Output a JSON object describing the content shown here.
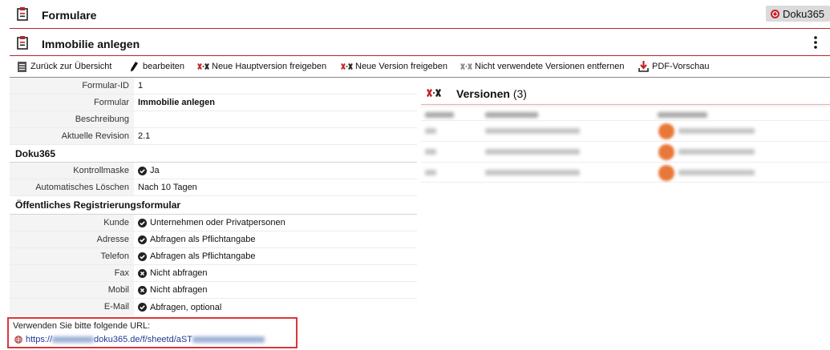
{
  "header": {
    "title": "Formulare",
    "badge": "Doku365"
  },
  "form": {
    "title": "Immobilie anlegen"
  },
  "toolbar": {
    "items": [
      {
        "label": "Zurück zur Übersicht",
        "icon": "list-icon"
      },
      {
        "label": "bearbeiten",
        "icon": "pencil-icon"
      },
      {
        "label": "Neue Hauptversion freigeben",
        "icon": "release-major-version-icon"
      },
      {
        "label": "Neue Version freigeben",
        "icon": "release-version-icon"
      },
      {
        "label": "Nicht verwendete Versionen entfernen",
        "icon": "remove-versions-icon"
      },
      {
        "label": "PDF-Vorschau",
        "icon": "pdf-download-icon"
      }
    ]
  },
  "details": {
    "general": [
      {
        "label": "Formular-ID",
        "value": "1"
      },
      {
        "label": "Formular",
        "value": "Immobilie anlegen"
      },
      {
        "label": "Beschreibung"
      },
      {
        "label": "Aktuelle Revision",
        "value": "2.1"
      }
    ],
    "doku365": {
      "heading": "Doku365",
      "rows": [
        {
          "label": "Kontrollmaske",
          "value": "Ja",
          "status": "check-circle-icon"
        },
        {
          "label": "Automatisches Löschen",
          "value": "Nach 10 Tagen"
        }
      ]
    },
    "registration": {
      "heading": "Öffentliches Registrierungsformular",
      "rows": [
        {
          "label": "Kunde",
          "value": "Unternehmen oder Privatpersonen",
          "status": "check-circle-icon"
        },
        {
          "label": "Adresse",
          "value": "Abfragen als Pflichtangabe",
          "status": "check-circle-icon"
        },
        {
          "label": "Telefon",
          "value": "Abfragen als Pflichtangabe",
          "status": "check-circle-icon"
        },
        {
          "label": "Fax",
          "value": "Nicht abfragen",
          "status": "cross-circle-icon"
        },
        {
          "label": "Mobil",
          "value": "Nicht abfragen",
          "status": "cross-circle-icon"
        },
        {
          "label": "E-Mail",
          "value": "Abfragen, optional",
          "status": "check-circle-icon"
        }
      ]
    }
  },
  "url_box": {
    "label": "Verwenden Sie bitte folgende URL:",
    "url_prefix": "https://",
    "url_visible": "doku365.de/f/sheetd/aST",
    "icon": "globe-icon"
  },
  "versions": {
    "title": "Versionen",
    "count_label": "(3)",
    "icon": "versions-icon"
  },
  "colors": {
    "accent_red": "#b3262c",
    "link": "#1f3a93",
    "avatar_orange": "#e8783a",
    "url_box_border": "#d9363e"
  }
}
